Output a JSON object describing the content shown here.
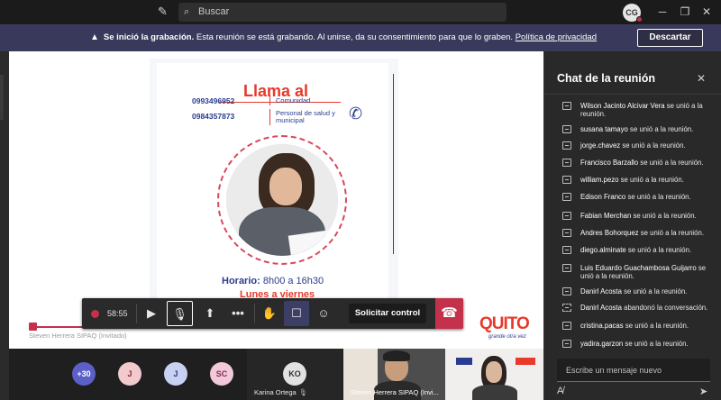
{
  "titlebar": {
    "search_placeholder": "Buscar",
    "avatar_initials": "CG"
  },
  "banner": {
    "bold": "Se inició la grabación.",
    "text": " Esta reunión se está grabando. Al unirse, da su consentimiento para que lo graben. ",
    "link": "Política de privacidad",
    "dismiss_label": "Descartar"
  },
  "shared": {
    "presenter": "Steven Herrera SIPAQ (Invitado)",
    "poster": {
      "title": "Llama al",
      "phone1": "0993496952",
      "desc1": "Comunidad",
      "phone2": "0984357873",
      "desc2": "Personal de salud y municipal",
      "horario_label": "Horario:",
      "horario_value": " 8h00 a 16h30",
      "dias": "Lunes a viernes"
    },
    "logo": {
      "name": "QUITO",
      "tagline": "grande otra vez"
    }
  },
  "controls": {
    "timer": "58:55",
    "request_label": "Solicitar control"
  },
  "participants": {
    "more": "+30",
    "avatars": [
      {
        "initials": "J",
        "bg": "#f2c9cc",
        "fg": "#8a2a33"
      },
      {
        "initials": "J",
        "bg": "#c8d1f2",
        "fg": "#2e3a85"
      },
      {
        "initials": "SC",
        "bg": "#f2c9d8",
        "fg": "#8a2a55"
      }
    ],
    "tiles": [
      {
        "initials": "KO",
        "name": "Karina Ortega"
      },
      {
        "name": "Steven Herrera SIPAQ (Invi..."
      }
    ]
  },
  "chat": {
    "title": "Chat de la reunión",
    "events": [
      {
        "who": "Wilson Jacinto Alcivar Vera",
        "action": " se unió a la reunión."
      },
      {
        "who": "susana tamayo",
        "action": " se unió a la reunión."
      },
      {
        "who": "jorge.chavez",
        "action": " se unió a la reunión."
      },
      {
        "who": "Francisco Barzallo",
        "action": " se unió a la reunión."
      },
      {
        "who": "william.pezo",
        "action": " se unió a la reunión."
      },
      {
        "who": "Edison Franco",
        "action": " se unió a la reunión."
      },
      {
        "who": "Fabian Merchan",
        "action": " se unió a la reunión."
      },
      {
        "who": "Andres Bohorquez",
        "action": " se unió a la reunión."
      },
      {
        "who": "diego.alminate",
        "action": " se unió a la reunión."
      },
      {
        "who": "Luis Eduardo Guachambosa Guijarro",
        "action": " se unió a la reunión."
      },
      {
        "who": "Danirl Acosta",
        "action": " se unió a la reunión."
      },
      {
        "who": "Danirl Acosta",
        "action": " abandonó la conversación."
      },
      {
        "who": "cristina.pacas",
        "action": " se unió a la reunión."
      },
      {
        "who": "yadira.garzon",
        "action": " se unió a la reunión."
      }
    ],
    "input_placeholder": "Escribe un mensaje nuevo"
  }
}
